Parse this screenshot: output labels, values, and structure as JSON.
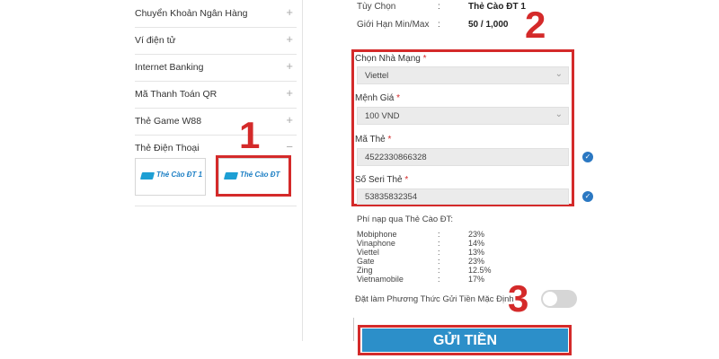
{
  "sidebar": {
    "items": [
      {
        "label": "Chuyển Khoản Ngân Hàng",
        "icon": "+"
      },
      {
        "label": "Ví điện tử",
        "icon": "+"
      },
      {
        "label": "Internet Banking",
        "icon": "+"
      },
      {
        "label": "Mã Thanh Toán QR",
        "icon": "+"
      },
      {
        "label": "Thẻ Game W88",
        "icon": "+"
      },
      {
        "label": "Thẻ Điện Thoại",
        "icon": "−"
      }
    ],
    "cards": [
      {
        "label": "Thẻ Cào ĐT 1"
      },
      {
        "label": "Thẻ Cào ĐT"
      }
    ]
  },
  "steps": [
    "1",
    "2",
    "3"
  ],
  "info": {
    "option_label": "Tùy Chọn",
    "option_value": "Thẻ Cào ĐT 1",
    "limit_label": "Giới Hạn Min/Max",
    "limit_value": "50 / 1,000",
    "colon": ":"
  },
  "form": {
    "carrier_label": "Chọn Nhà Mạng",
    "carrier_value": "Viettel",
    "amount_label": "Mệnh Giá",
    "amount_value": "100 VND",
    "code_label": "Mã Thẻ",
    "code_value": "4522330866328",
    "serial_label": "Số Seri Thẻ",
    "serial_value": "53835832354",
    "required_mark": "*",
    "caret": "⌄",
    "check": "✓"
  },
  "fees": {
    "title": "Phí nạp qua Thẻ Cào ĐT:",
    "rows": [
      {
        "name": "Mobiphone",
        "sep": ":",
        "rate": "23%"
      },
      {
        "name": "Vinaphone",
        "sep": ":",
        "rate": "14%"
      },
      {
        "name": "Viettel",
        "sep": ":",
        "rate": "13%"
      },
      {
        "name": "Gate",
        "sep": ":",
        "rate": "23%"
      },
      {
        "name": "Zing",
        "sep": ":",
        "rate": "12.5%"
      },
      {
        "name": "Vietnamobile",
        "sep": ":",
        "rate": "17%"
      }
    ]
  },
  "default_method_label": "Đặt làm Phương Thức Gửi Tiền Mặc Định",
  "submit_label": "GỬI TIỀN",
  "colors": {
    "accent": "#d42a2a",
    "button": "#2c8fc9",
    "check": "#2b78c2"
  }
}
